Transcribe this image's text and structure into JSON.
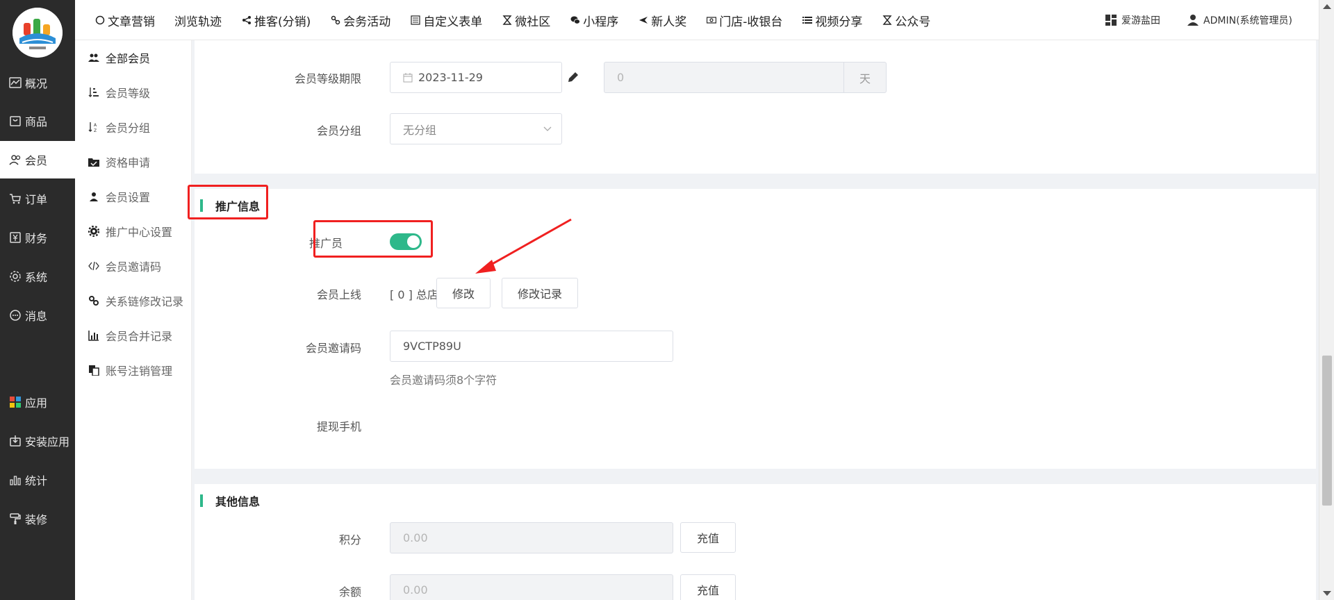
{
  "sidebar": {
    "items": [
      {
        "label": "概况",
        "icon": "chart-line-icon"
      },
      {
        "label": "商品",
        "icon": "box-icon"
      },
      {
        "label": "会员",
        "icon": "users-icon"
      },
      {
        "label": "订单",
        "icon": "cart-icon"
      },
      {
        "label": "财务",
        "icon": "yen-icon"
      },
      {
        "label": "系统",
        "icon": "gear-icon"
      },
      {
        "label": "消息",
        "icon": "chat-icon"
      },
      {
        "label": "应用",
        "icon": "apps-icon"
      },
      {
        "label": "安装应用",
        "icon": "download-box-icon"
      },
      {
        "label": "统计",
        "icon": "bar-chart-icon"
      },
      {
        "label": "装修",
        "icon": "paint-roller-icon"
      }
    ],
    "active": "会员"
  },
  "subnav": {
    "items": [
      {
        "label": "全部会员",
        "icon": "users-icon"
      },
      {
        "label": "会员等级",
        "icon": "sort-level-icon"
      },
      {
        "label": "会员分组",
        "icon": "sort-az-icon"
      },
      {
        "label": "资格申请",
        "icon": "folder-check-icon"
      },
      {
        "label": "会员设置",
        "icon": "user-icon"
      },
      {
        "label": "推广中心设置",
        "icon": "gear-icon"
      },
      {
        "label": "会员邀请码",
        "icon": "code-icon"
      },
      {
        "label": "关系链修改记录",
        "icon": "link-icon"
      },
      {
        "label": "会员合并记录",
        "icon": "bar-chart-icon"
      },
      {
        "label": "账号注销管理",
        "icon": "copy-icon"
      }
    ],
    "active": "全部会员"
  },
  "topnav": {
    "items": [
      {
        "label": "文章营销",
        "icon": "circle-icon"
      },
      {
        "label": "浏览轨迹",
        "icon": ""
      },
      {
        "label": "推客(分销)",
        "icon": "share-icon"
      },
      {
        "label": "会务活动",
        "icon": "link-icon"
      },
      {
        "label": "自定义表单",
        "icon": "form-icon"
      },
      {
        "label": "微社区",
        "icon": "hourglass-icon"
      },
      {
        "label": "小程序",
        "icon": "wechat-icon"
      },
      {
        "label": "新人奖",
        "icon": "plane-icon"
      },
      {
        "label": "门店-收银台",
        "icon": "money-icon"
      },
      {
        "label": "视频分享",
        "icon": "list-icon"
      },
      {
        "label": "公众号",
        "icon": "hourglass-icon"
      }
    ],
    "right": {
      "shop": "爱游盐田",
      "user": "ADMIN(系统管理员)"
    }
  },
  "form": {
    "level_expire_label": "会员等级期限",
    "level_expire_date": "2023-11-29",
    "level_expire_days": "0",
    "level_expire_unit": "天",
    "group_label": "会员分组",
    "group_value": "无分组",
    "promo_section_title": "推广信息",
    "promoter_label": "推广员",
    "promoter_enabled": true,
    "upline_label": "会员上线",
    "upline_value": "[ 0 ] 总店",
    "modify_button": "修改",
    "modify_log_button": "修改记录",
    "invite_label": "会员邀请码",
    "invite_value": "9VCTP89U",
    "invite_hint": "会员邀请码须8个字符",
    "withdraw_phone_label": "提现手机",
    "other_section_title": "其他信息",
    "points_label": "积分",
    "points_value": "0.00",
    "recharge_button": "充值",
    "balance_label": "余额",
    "balance_value": "0.00"
  },
  "colors": {
    "accent": "#2eb88a",
    "sidebar_bg": "#2b2b2b",
    "annotation_red": "#f02020"
  }
}
